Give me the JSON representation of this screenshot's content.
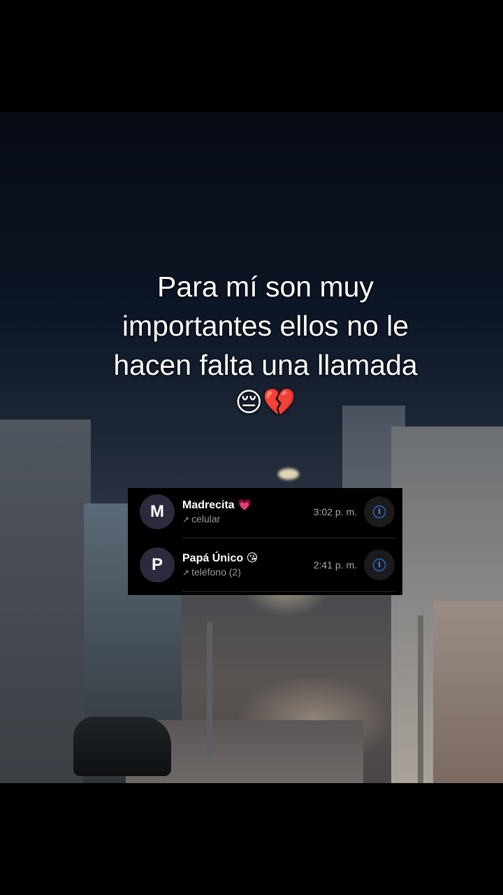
{
  "caption": {
    "line1": "Para mí son muy",
    "line2": "importantes ellos no le",
    "line3": "hacen falta una llamada",
    "emojis": "😔💔"
  },
  "calls": [
    {
      "avatar_letter": "M",
      "name": "Madrecita 💗",
      "type_icon": "outgoing-call-arrow",
      "arrow": "↗",
      "type": "celular",
      "time": "3:02 p. m.",
      "info_icon": "info-circle-icon"
    },
    {
      "avatar_letter": "P",
      "name": "Papá Único 😘",
      "type_icon": "outgoing-call-arrow",
      "arrow": "↗",
      "type": "teléfono (2)",
      "time": "2:41 p. m.",
      "info_icon": "info-circle-icon"
    }
  ],
  "colors": {
    "accent": "#2f8cff",
    "background": "#000000",
    "avatar": "#2c2a3d"
  }
}
